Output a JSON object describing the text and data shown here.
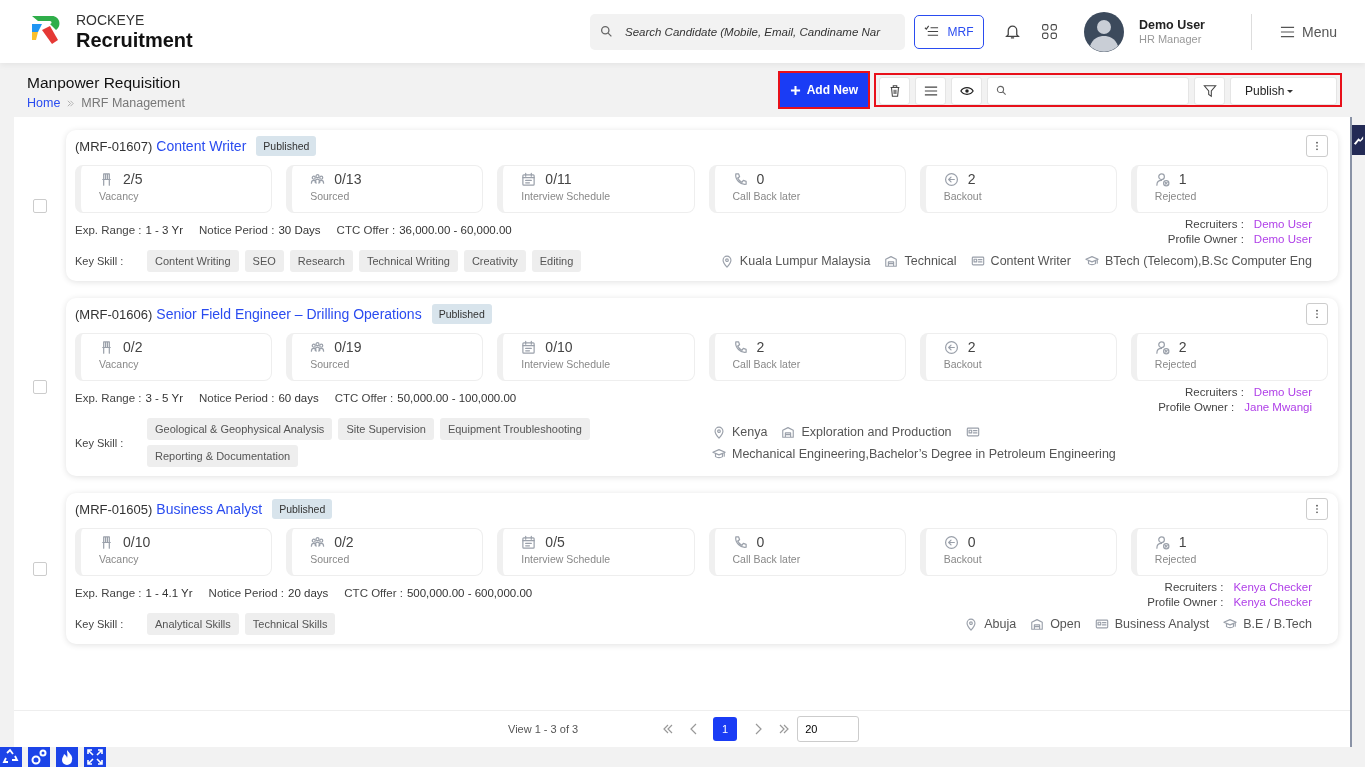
{
  "header": {
    "brand_top": "ROCKEYE",
    "brand_name": "Recruitment",
    "search": {
      "placeholder": "Search Candidate (Mobile, Email, Candiname Nar"
    },
    "mrf_button": "MRF",
    "user": {
      "name": "Demo User",
      "role": "HR Manager"
    },
    "menu": "Menu"
  },
  "page": {
    "title": "Manpower Requisition",
    "breadcrumb": [
      {
        "label": "Home",
        "link": true
      },
      {
        "label": "MRF Management",
        "link": false
      }
    ]
  },
  "toolbar": {
    "add_button": {
      "label": "Add New",
      "highlighted": true
    },
    "tools_highlighted": true,
    "status_dropdown": "Publish"
  },
  "cards": [
    {
      "checked": false,
      "code": "(MRF-01607)",
      "title": "Content Writer",
      "status": "Published",
      "stats": [
        {
          "kind": "vacancy",
          "value": "2/5",
          "label": "Vacancy"
        },
        {
          "kind": "sourced",
          "value": "0/13",
          "label": "Sourced"
        },
        {
          "kind": "interview",
          "value": "0/11",
          "label": "Interview Schedule"
        },
        {
          "kind": "callback",
          "value": "0",
          "label": "Call Back later"
        },
        {
          "kind": "backout",
          "value": "2",
          "label": "Backout"
        },
        {
          "kind": "rejected",
          "value": "1",
          "label": "Rejected"
        }
      ],
      "facts": [
        {
          "label": "Exp. Range :",
          "value": "1 - 3 Yr"
        },
        {
          "label": "Notice Period :",
          "value": "30 Days"
        },
        {
          "label": "CTC Offer :",
          "value": "36,000.00 - 60,000.00"
        }
      ],
      "people": [
        {
          "label": "Recruiters :",
          "value": "Demo User"
        },
        {
          "label": "Profile Owner :",
          "value": "Demo User"
        }
      ],
      "skill_label": "Key Skill :",
      "skills": [
        "Content Writing",
        "SEO",
        "Research",
        "Technical Writing",
        "Creativity",
        "Editing"
      ],
      "meta": [
        {
          "kind": "location",
          "text": "Kuala Lumpur Malaysia"
        },
        {
          "kind": "department",
          "text": "Technical"
        },
        {
          "kind": "designation",
          "text": "Content Writer"
        },
        {
          "kind": "education",
          "text": "BTech (Telecom),B.Sc Computer Eng"
        }
      ]
    },
    {
      "checked": false,
      "code": "(MRF-01606)",
      "title": "Senior Field Engineer – Drilling Operations",
      "status": "Published",
      "stats": [
        {
          "kind": "vacancy",
          "value": "0/2",
          "label": "Vacancy"
        },
        {
          "kind": "sourced",
          "value": "0/19",
          "label": "Sourced"
        },
        {
          "kind": "interview",
          "value": "0/10",
          "label": "Interview Schedule"
        },
        {
          "kind": "callback",
          "value": "2",
          "label": "Call Back later"
        },
        {
          "kind": "backout",
          "value": "2",
          "label": "Backout"
        },
        {
          "kind": "rejected",
          "value": "2",
          "label": "Rejected"
        }
      ],
      "facts": [
        {
          "label": "Exp. Range :",
          "value": "3 - 5 Yr"
        },
        {
          "label": "Notice Period :",
          "value": "60 days"
        },
        {
          "label": "CTC Offer :",
          "value": "50,000.00 - 100,000.00"
        }
      ],
      "people": [
        {
          "label": "Recruiters :",
          "value": "Demo User"
        },
        {
          "label": "Profile Owner :",
          "value": "Jane Mwangi"
        }
      ],
      "skill_label": "Key Skill :",
      "skills": [
        "Geological & Geophysical Analysis",
        "Site Supervision",
        "Equipment Troubleshooting",
        "Reporting & Documentation"
      ],
      "meta": [
        {
          "kind": "location",
          "text": "Kenya"
        },
        {
          "kind": "department",
          "text": "Exploration and Production"
        },
        {
          "kind": "designation"
        },
        {
          "kind": "education",
          "text": "Mechanical Engineering,Bachelor’s Degree in Petroleum Engineering"
        }
      ]
    },
    {
      "checked": false,
      "code": "(MRF-01605)",
      "title": "Business Analyst",
      "status": "Published",
      "stats": [
        {
          "kind": "vacancy",
          "value": "0/10",
          "label": "Vacancy"
        },
        {
          "kind": "sourced",
          "value": "0/2",
          "label": "Sourced"
        },
        {
          "kind": "interview",
          "value": "0/5",
          "label": "Interview Schedule"
        },
        {
          "kind": "callback",
          "value": "0",
          "label": "Call Back later"
        },
        {
          "kind": "backout",
          "value": "0",
          "label": "Backout"
        },
        {
          "kind": "rejected",
          "value": "1",
          "label": "Rejected"
        }
      ],
      "facts": [
        {
          "label": "Exp. Range :",
          "value": "1 - 4.1 Yr"
        },
        {
          "label": "Notice Period :",
          "value": "20 days"
        },
        {
          "label": "CTC Offer :",
          "value": "500,000.00 - 600,000.00"
        }
      ],
      "people": [
        {
          "label": "Recruiters :",
          "value": "Kenya Checker"
        },
        {
          "label": "Profile Owner :",
          "value": "Kenya Checker"
        }
      ],
      "skill_label": "Key Skill :",
      "skills": [
        "Analytical Skills",
        "Technical Skills"
      ],
      "meta": [
        {
          "kind": "location",
          "text": "Abuja"
        },
        {
          "kind": "department",
          "text": "Open"
        },
        {
          "kind": "designation",
          "text": "Business Analyst"
        },
        {
          "kind": "education",
          "text": "B.E / B.Tech"
        }
      ]
    }
  ],
  "pagination": {
    "summary": "View 1 - 3 of 3",
    "pages": [
      {
        "label": "1",
        "selected": true
      }
    ],
    "page_size": "20"
  }
}
